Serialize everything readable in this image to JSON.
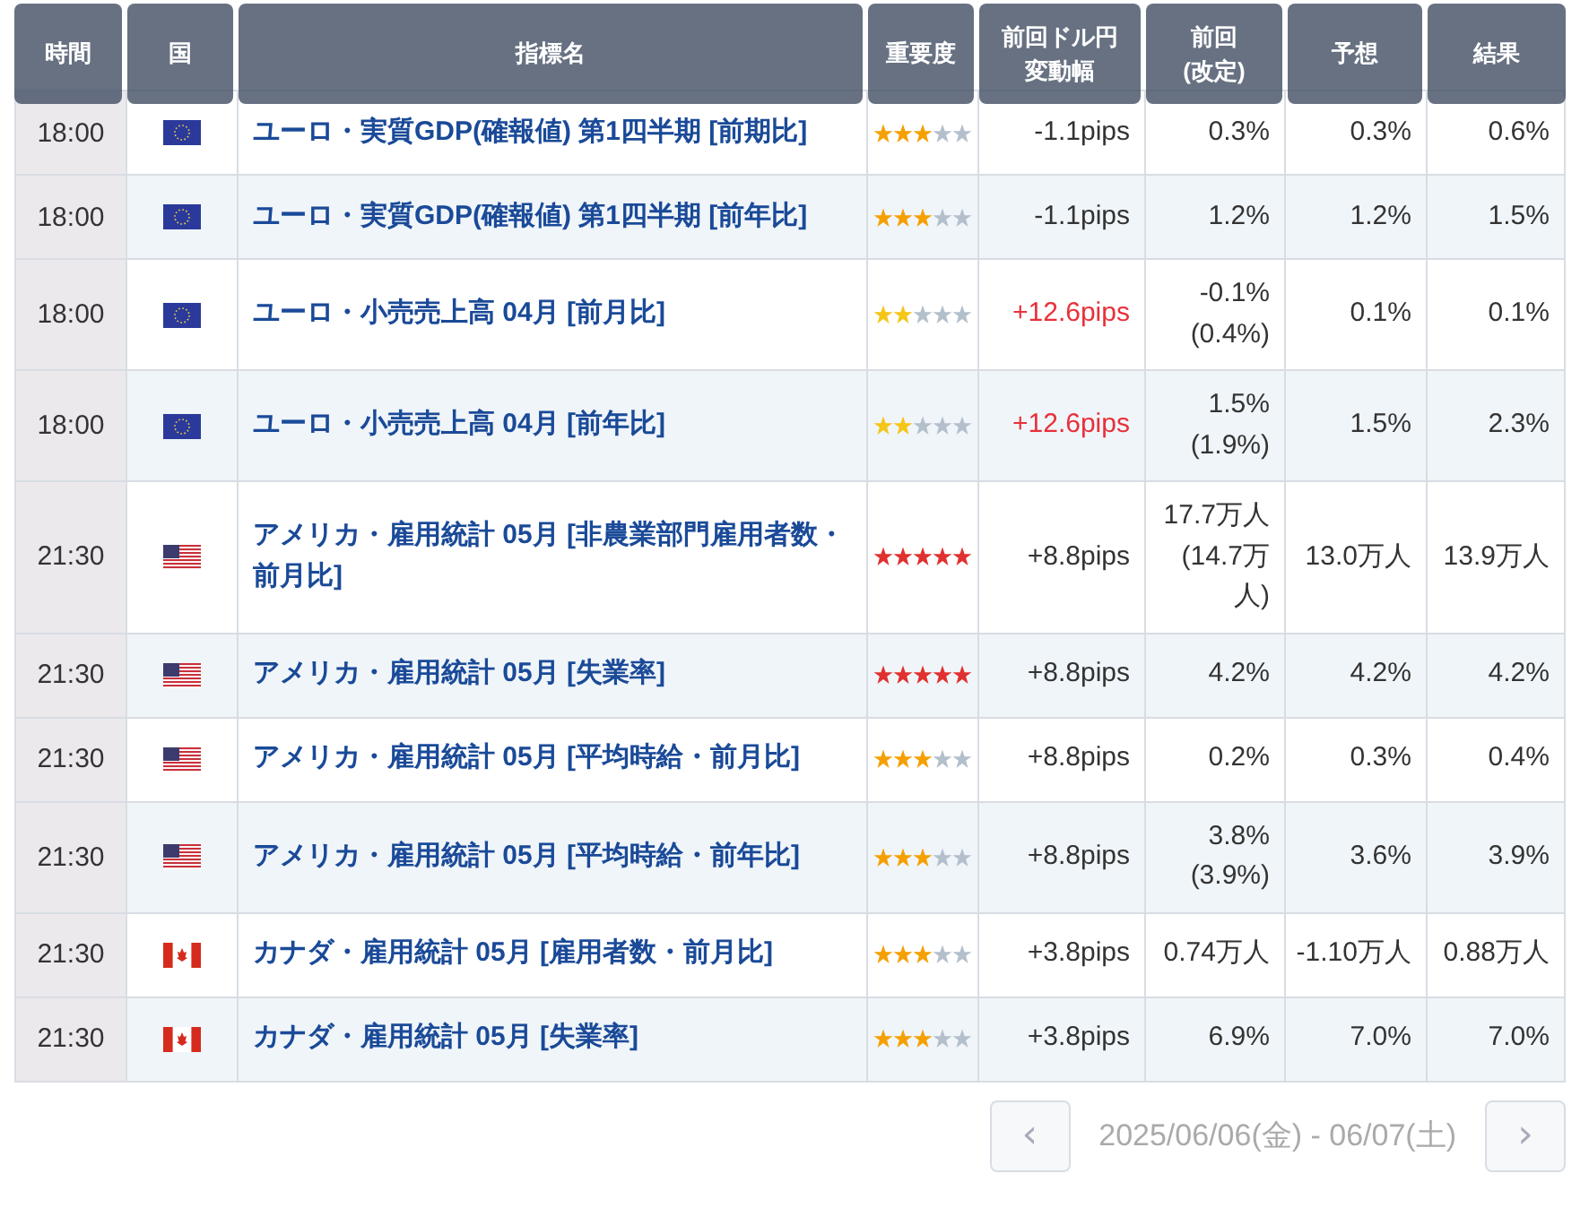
{
  "header": [
    [
      "時間"
    ],
    [
      "国"
    ],
    [
      "指標名"
    ],
    [
      "重要度"
    ],
    [
      "前回ドル円",
      "変動幅"
    ],
    [
      "前回",
      "(改定)"
    ],
    [
      "予想"
    ],
    [
      "結果"
    ]
  ],
  "rows": [
    {
      "time": "18:00",
      "flag": {
        "kind": "eu"
      },
      "name": "ユーロ・実質GDP(確報値) 第1四半期 [前期比]",
      "stars": 3,
      "pips": "-1.1pips",
      "pips_alert": false,
      "previous": "0.3%",
      "forecast": "0.3%",
      "result": "0.6%"
    },
    {
      "time": "18:00",
      "flag": {
        "kind": "eu"
      },
      "name": "ユーロ・実質GDP(確報値) 第1四半期 [前年比]",
      "stars": 3,
      "pips": "-1.1pips",
      "pips_alert": false,
      "previous": "1.2%",
      "forecast": "1.2%",
      "result": "1.5%"
    },
    {
      "time": "18:00",
      "flag": {
        "kind": "eu"
      },
      "name": "ユーロ・小売売上高 04月 [前月比]",
      "stars": 2,
      "pips": "+12.6pips",
      "pips_alert": true,
      "previous": "-0.1%",
      "revised": "(0.4%)",
      "forecast": "0.1%",
      "result": "0.1%"
    },
    {
      "time": "18:00",
      "flag": {
        "kind": "eu"
      },
      "name": "ユーロ・小売売上高 04月 [前年比]",
      "stars": 2,
      "pips": "+12.6pips",
      "pips_alert": true,
      "previous": "1.5%",
      "revised": "(1.9%)",
      "forecast": "1.5%",
      "result": "2.3%"
    },
    {
      "time": "21:30",
      "flag": {
        "kind": "us"
      },
      "name": "アメリカ・雇用統計 05月 [非農業部門雇用者数・前月比]",
      "stars": 5,
      "pips": "+8.8pips",
      "pips_alert": false,
      "previous": "17.7万人",
      "revised": "(14.7万人)",
      "forecast": "13.0万人",
      "result": "13.9万人"
    },
    {
      "time": "21:30",
      "flag": {
        "kind": "us"
      },
      "name": "アメリカ・雇用統計 05月 [失業率]",
      "stars": 5,
      "pips": "+8.8pips",
      "pips_alert": false,
      "previous": "4.2%",
      "forecast": "4.2%",
      "result": "4.2%"
    },
    {
      "time": "21:30",
      "flag": {
        "kind": "us"
      },
      "name": "アメリカ・雇用統計 05月 [平均時給・前月比]",
      "stars": 3,
      "pips": "+8.8pips",
      "pips_alert": false,
      "previous": "0.2%",
      "forecast": "0.3%",
      "result": "0.4%"
    },
    {
      "time": "21:30",
      "flag": {
        "kind": "us"
      },
      "name": "アメリカ・雇用統計 05月 [平均時給・前年比]",
      "stars": 3,
      "pips": "+8.8pips",
      "pips_alert": false,
      "previous": "3.8%",
      "revised": "(3.9%)",
      "forecast": "3.6%",
      "result": "3.9%"
    },
    {
      "time": "21:30",
      "flag": {
        "kind": "ca"
      },
      "name": "カナダ・雇用統計 05月 [雇用者数・前月比]",
      "stars": 3,
      "pips": "+3.8pips",
      "pips_alert": false,
      "previous": "0.74万人",
      "forecast": "-1.10万人",
      "result": "0.88万人"
    },
    {
      "time": "21:30",
      "flag": {
        "kind": "ca"
      },
      "name": "カナダ・雇用統計 05月 [失業率]",
      "stars": 3,
      "pips": "+3.8pips",
      "pips_alert": false,
      "previous": "6.9%",
      "forecast": "7.0%",
      "result": "7.0%"
    }
  ],
  "pager": {
    "prev": "‹",
    "range": "2025/06/06(金) - 06/07(土)",
    "next": "›"
  }
}
